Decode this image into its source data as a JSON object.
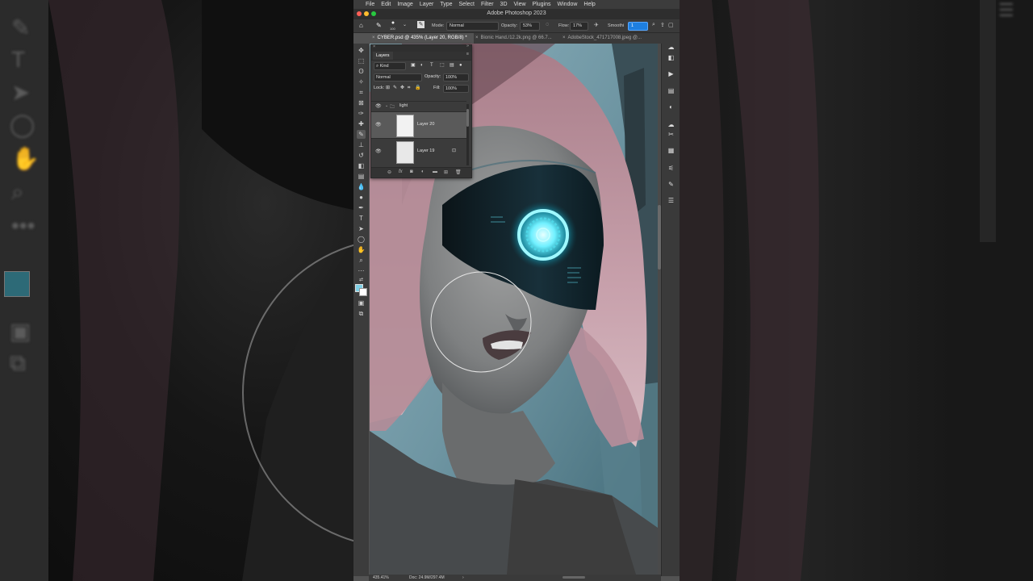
{
  "menu": {
    "apple": "",
    "items": [
      "File",
      "Edit",
      "Image",
      "Layer",
      "Type",
      "Select",
      "Filter",
      "3D",
      "View",
      "Plugins",
      "Window",
      "Help"
    ]
  },
  "window": {
    "title": "Adobe Photoshop 2023",
    "traffic_colors": [
      "#ff5f57",
      "#febc2e",
      "#28c840"
    ]
  },
  "options": {
    "brush_size": "100",
    "mode_label": "Mode:",
    "mode_value": "Normal",
    "opacity_label": "Opacity:",
    "opacity_value": "53%",
    "flow_label": "Flow:",
    "flow_value": "17%",
    "smoothing_label": "Smoothi",
    "smoothing_value": "1"
  },
  "tabs": [
    {
      "label": "CYBER.psd @ 435% (Layer 20, RGB/8) *",
      "active": true
    },
    {
      "label": "Bionic Hand./12.2k.png @ 66.7...",
      "active": false
    },
    {
      "label": "AdobeStock_471717008.jpeg @...",
      "active": false
    }
  ],
  "layers_panel": {
    "tab": "Layers",
    "kind_label": "Kind",
    "blend_mode": "Normal",
    "opacity_label": "Opacity:",
    "opacity_value": "100%",
    "lock_label": "Lock:",
    "fill_label": "Fill:",
    "fill_value": "100%",
    "group": {
      "name": "light"
    },
    "layers": [
      {
        "name": "Layer 20",
        "selected": true
      },
      {
        "name": "Layer 19",
        "selected": false
      }
    ],
    "footer_icons": [
      "link-icon",
      "fx-icon",
      "mask-icon",
      "adjustment-icon",
      "folder-icon",
      "new-layer-icon",
      "trash-icon"
    ]
  },
  "status": {
    "zoom": "435.41%",
    "doc": "Doc: 24.9M/297.4M"
  },
  "colors": {
    "foreground": "#7fd0e6",
    "background": "#ffffff",
    "accent": "#1e7fe0"
  }
}
